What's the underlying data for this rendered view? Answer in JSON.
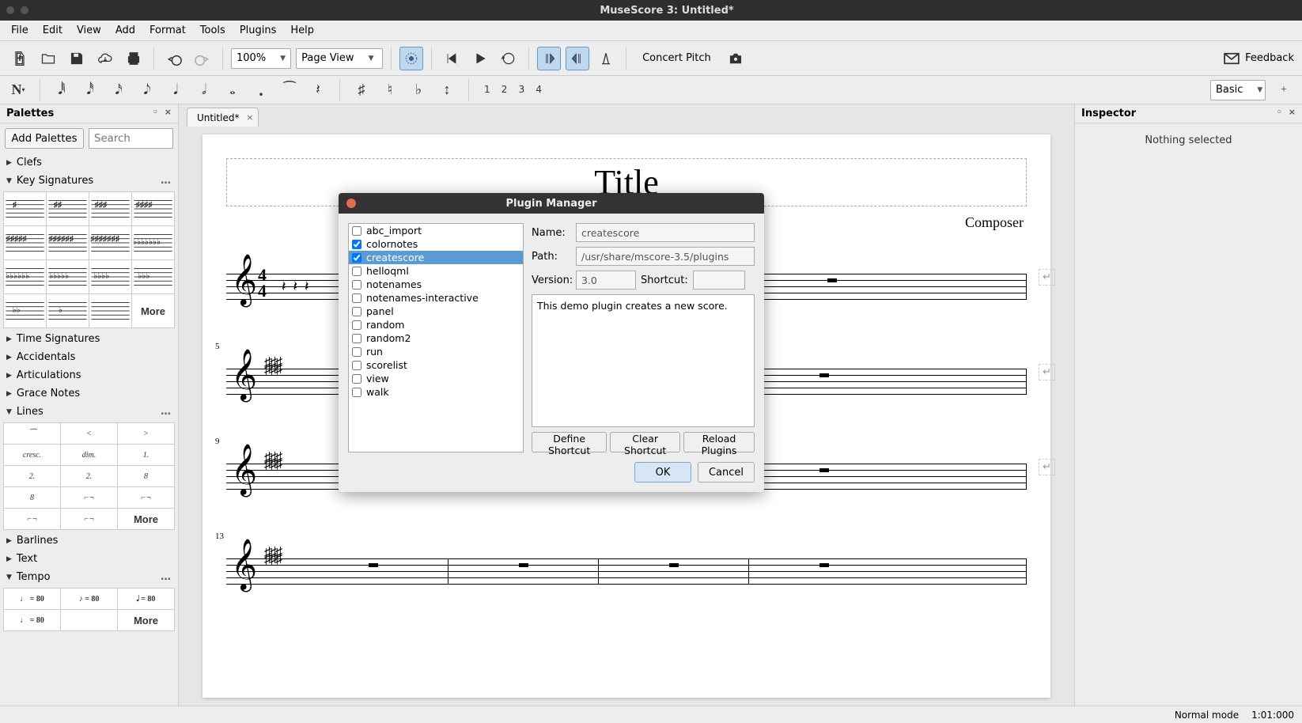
{
  "window_title": "MuseScore 3: Untitled*",
  "menu": [
    "File",
    "Edit",
    "View",
    "Add",
    "Format",
    "Tools",
    "Plugins",
    "Help"
  ],
  "toolbar": {
    "zoom": "100%",
    "view_mode": "Page View",
    "concert_pitch": "Concert Pitch",
    "feedback": "Feedback",
    "workspace": "Basic"
  },
  "voices": [
    "1",
    "2",
    "3",
    "4"
  ],
  "palettes": {
    "title": "Palettes",
    "add_btn": "Add Palettes",
    "search_placeholder": "Search",
    "sections": {
      "clefs": "Clefs",
      "keysig": "Key Signatures",
      "timesig": "Time Signatures",
      "accidentals": "Accidentals",
      "articulations": "Articulations",
      "grace": "Grace Notes",
      "lines": "Lines",
      "barlines": "Barlines",
      "text": "Text",
      "tempo": "Tempo"
    },
    "more": "More",
    "lines_items": [
      "",
      "",
      "",
      "cresc.",
      "dim.",
      "1.",
      "2.",
      "2.",
      "8",
      "8",
      "",
      ""
    ],
    "tempo_items": [
      "♩ = 80",
      "♪ = 80",
      "𝅗𝅥 = 80",
      "♩ = 80",
      "",
      ""
    ]
  },
  "tab": "Untitled*",
  "score": {
    "title": "Title",
    "composer": "Composer",
    "measure_nums": [
      "",
      "5",
      "9",
      "13"
    ]
  },
  "inspector": {
    "title": "Inspector",
    "empty": "Nothing selected"
  },
  "statusbar": {
    "mode": "Normal mode",
    "pos": "1:01:000"
  },
  "dialog": {
    "title": "Plugin Manager",
    "plugins": [
      {
        "name": "abc_import",
        "checked": false
      },
      {
        "name": "colornotes",
        "checked": true
      },
      {
        "name": "createscore",
        "checked": true,
        "selected": true
      },
      {
        "name": "helloqml",
        "checked": false
      },
      {
        "name": "notenames",
        "checked": false
      },
      {
        "name": "notenames-interactive",
        "checked": false
      },
      {
        "name": "panel",
        "checked": false
      },
      {
        "name": "random",
        "checked": false
      },
      {
        "name": "random2",
        "checked": false
      },
      {
        "name": "run",
        "checked": false
      },
      {
        "name": "scorelist",
        "checked": false
      },
      {
        "name": "view",
        "checked": false
      },
      {
        "name": "walk",
        "checked": false
      }
    ],
    "labels": {
      "name": "Name:",
      "path": "Path:",
      "version": "Version:",
      "shortcut": "Shortcut:"
    },
    "values": {
      "name": "createscore",
      "path": "/usr/share/mscore-3.5/plugins",
      "version": "3.0",
      "shortcut": ""
    },
    "desc": "This demo plugin creates a new score.",
    "buttons": {
      "define": "Define Shortcut",
      "clear": "Clear Shortcut",
      "reload": "Reload Plugins",
      "ok": "OK",
      "cancel": "Cancel"
    }
  }
}
